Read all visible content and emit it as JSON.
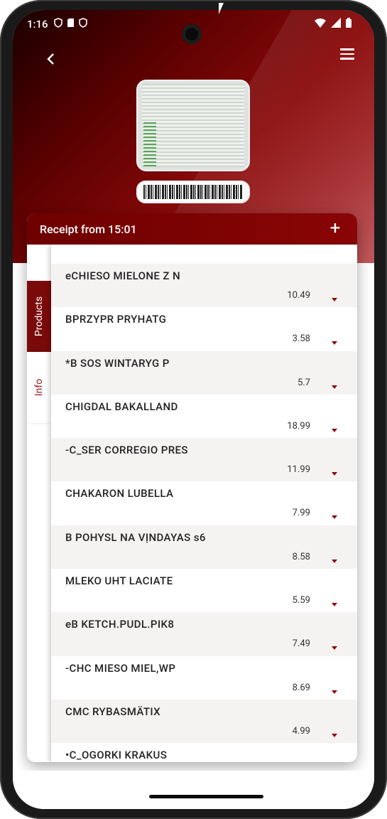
{
  "status": {
    "time": "1:16",
    "left_icons": [
      "shield-icon",
      "sd-card-icon",
      "shield-icon"
    ],
    "right_icons": [
      "wifi-icon",
      "signal-icon",
      "battery-icon"
    ]
  },
  "header": {
    "back_icon": "arrow-left-icon",
    "menu_icon": "hamburger-icon"
  },
  "receipt_card": {
    "title": "Receipt from 15:01",
    "add_label": "+"
  },
  "tabs": [
    {
      "label": "Products",
      "active": true
    },
    {
      "label": "Info",
      "active": false
    }
  ],
  "products": [
    {
      "name": "eCHIESO MIELONE Z N",
      "price": "10.49"
    },
    {
      "name": "BPRZYPR PRYHATG",
      "price": "3.58"
    },
    {
      "name": "*B SOS WINTARYG P",
      "price": "5.7"
    },
    {
      "name": "CHIGDAL BAKALLAND",
      "price": "18.99"
    },
    {
      "name": "-C_SER CORREGIO PRES",
      "price": "11.99"
    },
    {
      "name": "CHAKARON LUBELLA",
      "price": "7.99"
    },
    {
      "name": "B POHYSL NA VỊNDAYAS s6",
      "price": "8.58"
    },
    {
      "name": "MLEKO UHT LACIATE",
      "price": "5.59"
    },
    {
      "name": "eB KETCH.PUDL.PIK8",
      "price": "7.49"
    },
    {
      "name": "-CHC MIESO MIEL,WP",
      "price": "8.69"
    },
    {
      "name": "CMC RYBASMÄTIX",
      "price": "4.99"
    },
    {
      "name": "•C_OGORKI KRAKUS",
      "price": ""
    }
  ],
  "colors": {
    "accent": "#7a0a0a",
    "header_dark": "#1a0000",
    "header_light": "#c0585c"
  }
}
